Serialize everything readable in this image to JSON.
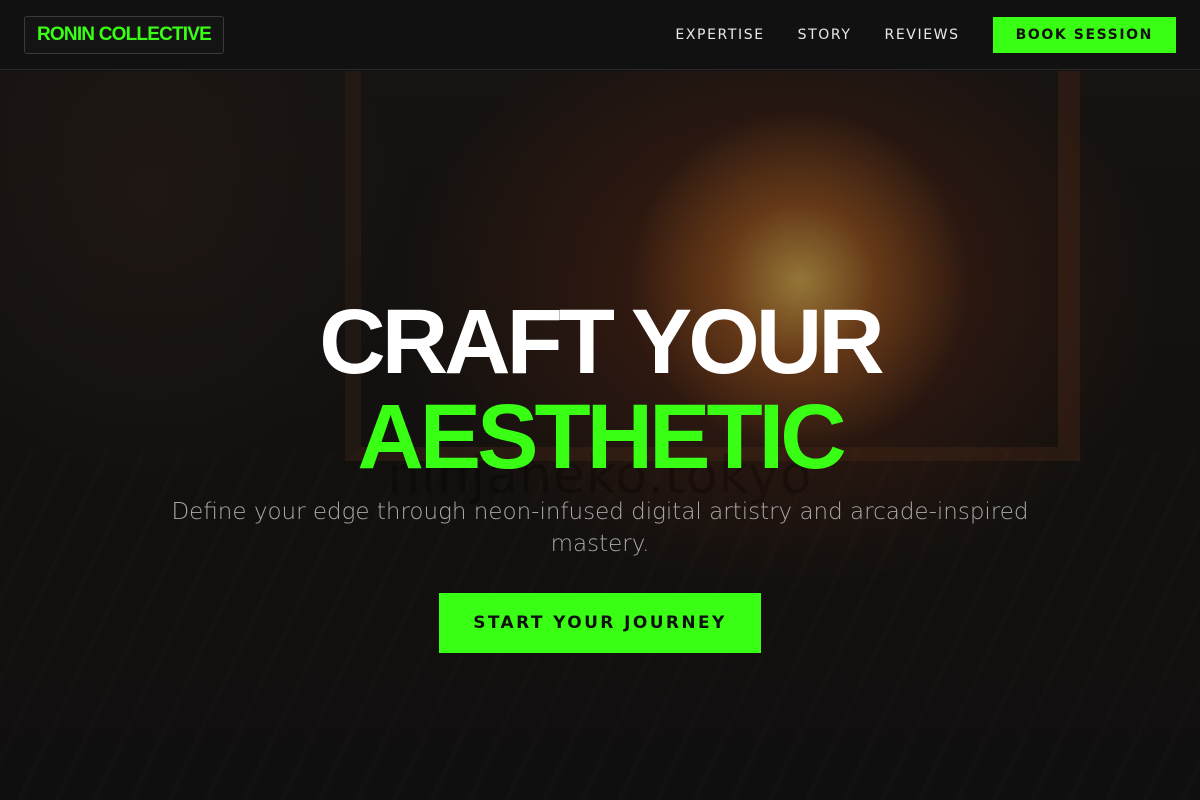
{
  "nav": {
    "brand": "RONIN COLLECTIVE",
    "links": [
      "EXPERTISE",
      "STORY",
      "REVIEWS"
    ],
    "cta": "BOOK SESSION"
  },
  "hero": {
    "title_line1": "CRAFT YOUR",
    "title_line2": "AESTHETIC",
    "watermark": "ninjaneko.tokyo",
    "subtitle": "Define your edge through neon-infused digital artistry and arcade-inspired mastery.",
    "cta": "START YOUR JOURNEY"
  },
  "colors": {
    "accent": "#39ff14",
    "background": "#111111",
    "text": "#ffffff",
    "muted": "#a9a9a9"
  }
}
